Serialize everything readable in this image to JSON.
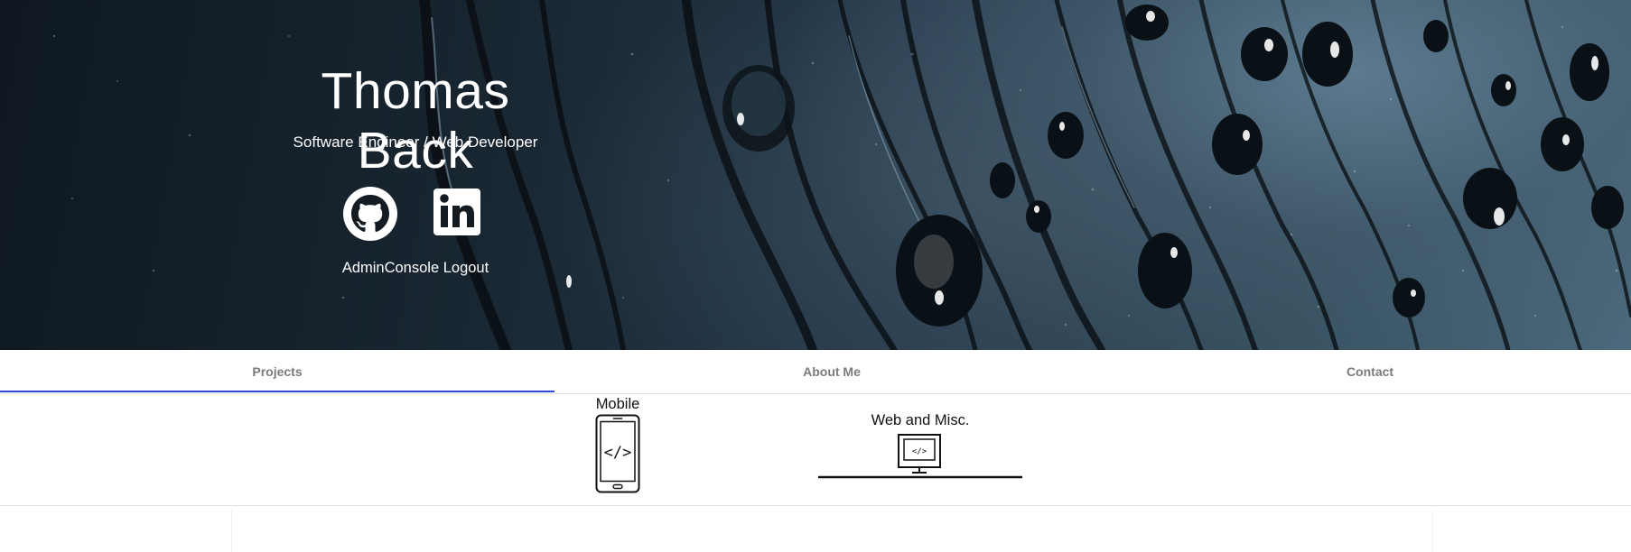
{
  "hero": {
    "title": "Thomas Back",
    "subtitle": "Software Engineer / Web Developer",
    "social": [
      {
        "icon": "github-icon"
      },
      {
        "icon": "linkedin-icon"
      }
    ],
    "admin_label": "AdminConsole",
    "logout_label": "Logout"
  },
  "tabs": [
    {
      "label": "Projects",
      "active": true
    },
    {
      "label": "About Me",
      "active": false
    },
    {
      "label": "Contact",
      "active": false
    }
  ],
  "categories": [
    {
      "label": "Mobile",
      "icon": "mobile-code-icon"
    },
    {
      "label": "Web and Misc.",
      "icon": "monitor-code-icon"
    }
  ],
  "colors": {
    "accent": "#2f47d4",
    "tab_text": "#7b7b7b",
    "hero_text": "#ffffff"
  }
}
